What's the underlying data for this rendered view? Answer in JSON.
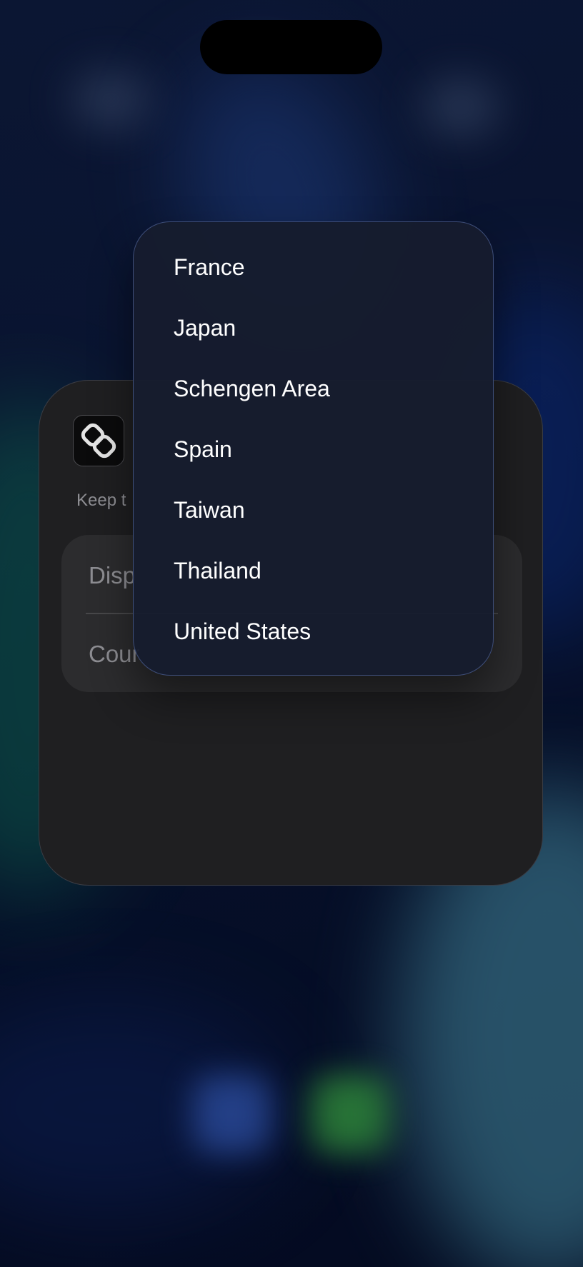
{
  "background": {
    "colors": {
      "base": "#050a1c",
      "accent_blue": "#1d3a7a",
      "accent_green": "#0d5a4a",
      "accent_teal": "#3f7f95"
    }
  },
  "widget": {
    "app_icon": "linked-rings-icon",
    "description_text": "Keep t",
    "rows": [
      {
        "label": "Disp"
      },
      {
        "label": "Cour"
      }
    ],
    "colors": {
      "card": "#1f1f21",
      "group": "#2c2c2e",
      "label": "#8e8e93"
    }
  },
  "country_menu": {
    "items": [
      {
        "label": "France"
      },
      {
        "label": "Japan"
      },
      {
        "label": "Schengen Area"
      },
      {
        "label": "Spain"
      },
      {
        "label": "Taiwan"
      },
      {
        "label": "Thailand"
      },
      {
        "label": "United States"
      }
    ],
    "colors": {
      "background": "#161c2e",
      "border": "#3d4d78",
      "text": "#ffffff"
    }
  }
}
